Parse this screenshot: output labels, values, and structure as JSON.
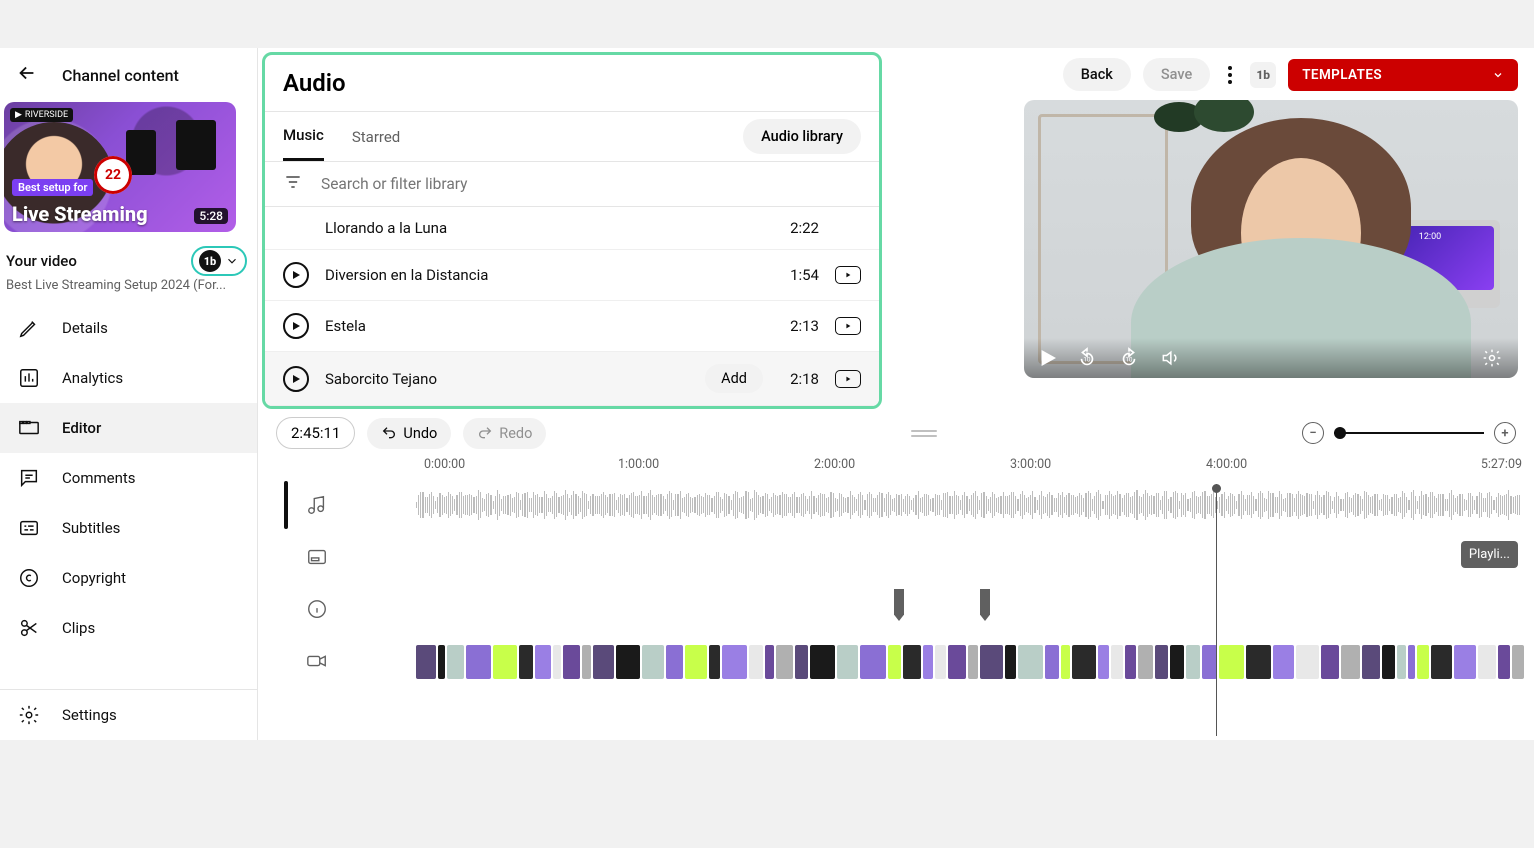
{
  "header": {
    "title": "Channel content"
  },
  "thumbnail": {
    "brand": "RIVERSIDE",
    "banner": "Best setup for",
    "title": "Live Streaming",
    "badge": "22",
    "duration": "5:28"
  },
  "yourVideo": {
    "label": "Your video",
    "subtitle": "Best Live Streaming Setup 2024 (For...",
    "chipLogo": "1b"
  },
  "nav": {
    "details": "Details",
    "analytics": "Analytics",
    "editor": "Editor",
    "comments": "Comments",
    "subtitles": "Subtitles",
    "copyright": "Copyright",
    "clips": "Clips",
    "settings": "Settings"
  },
  "topbar": {
    "back": "Back",
    "save": "Save",
    "tbLogo": "1b",
    "templates": "TEMPLATES"
  },
  "audio": {
    "title": "Audio",
    "tabs": {
      "music": "Music",
      "starred": "Starred"
    },
    "libraryBtn": "Audio library",
    "searchPlaceholder": "Search or filter library",
    "addLabel": "Add",
    "tracks": [
      {
        "name": "Llorando a la Luna",
        "duration": "2:22"
      },
      {
        "name": "Diversion en la Distancia",
        "duration": "1:54"
      },
      {
        "name": "Estela",
        "duration": "2:13"
      },
      {
        "name": "Saborcito Tejano",
        "duration": "2:18"
      }
    ]
  },
  "preview": {
    "laptopTime": "12:00"
  },
  "editor": {
    "time": "2:45:11",
    "undo": "Undo",
    "redo": "Redo",
    "ruler": [
      "0:00:00",
      "1:00:00",
      "2:00:00",
      "3:00:00",
      "4:00:00",
      "5:27:09"
    ],
    "endcard": "Playli..."
  }
}
